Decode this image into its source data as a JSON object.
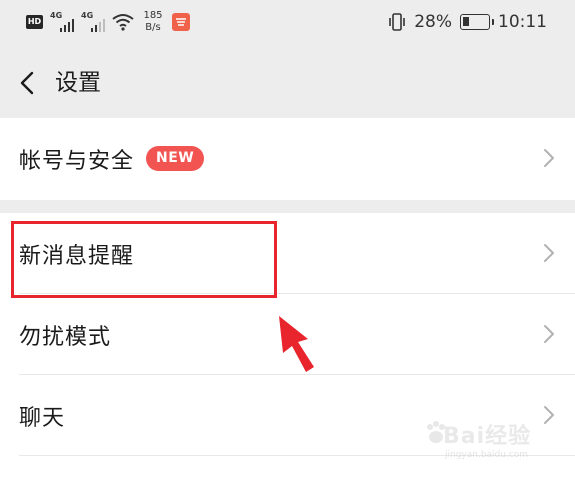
{
  "status_bar": {
    "hd": "HD",
    "signal1_tag": "4G",
    "signal2_tag": "4G",
    "speed_value": "185",
    "speed_unit": "B/s",
    "battery": "28%",
    "battery_level": 0.28,
    "time": "10:11"
  },
  "header": {
    "title": "设置"
  },
  "groups": [
    {
      "items": [
        {
          "label": "帐号与安全",
          "badge": "NEW"
        }
      ]
    },
    {
      "items": [
        {
          "label": "新消息提醒"
        },
        {
          "label": "勿扰模式"
        },
        {
          "label": "聊天"
        }
      ]
    }
  ],
  "watermark": {
    "main": "Bai经验",
    "url": "jingyan.baidu.com"
  },
  "colors": {
    "badge": "#f25452",
    "highlight": "#e8252c",
    "background": "#ededed"
  }
}
